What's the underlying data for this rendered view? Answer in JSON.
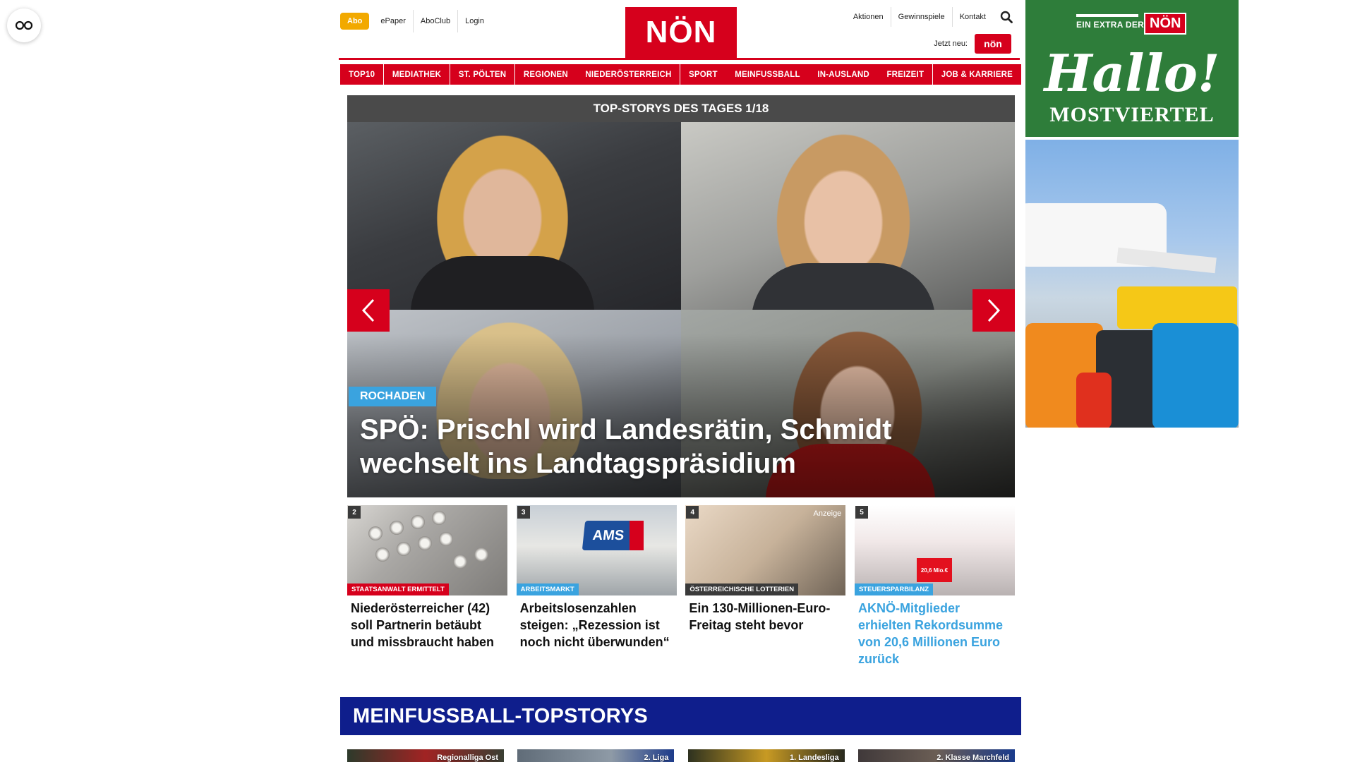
{
  "header": {
    "abo": "Abo",
    "util_links": [
      "ePaper",
      "AboClub",
      "Login"
    ],
    "logo": "NÖN",
    "right_links": [
      "Aktionen",
      "Gewinnspiele",
      "Kontakt"
    ],
    "jetzt_neu": "Jetzt neu:",
    "mini_logo": "nön"
  },
  "nav": [
    "TOP10",
    "MEDIATHEK",
    "ST. PÖLTEN",
    "REGIONEN",
    "NIEDERÖSTERREICH",
    "SPORT",
    "MEINFUSSBALL",
    "IN-AUSLAND",
    "FREIZEIT",
    "JOB & KARRIERE"
  ],
  "top_stories": {
    "heading": "TOP-STORYS DES TAGES 1/18",
    "tag": "ROCHADEN",
    "title": "SPÖ: Prischl wird Landesrätin, Schmidt wechselt ins Landtagspräsidium"
  },
  "cards": [
    {
      "num": "2",
      "tag": "STAATSANWALT ERMITTELT",
      "tag_color": "#d6001c",
      "title": "Niederösterreicher (42) soll Partnerin betäubt und missbraucht haben",
      "ad": ""
    },
    {
      "num": "3",
      "tag": "ARBEITSMARKT",
      "tag_color": "#3aa3df",
      "title": "Arbeitslosenzahlen steigen: „Rezession ist noch nicht überwunden“",
      "ad": ""
    },
    {
      "num": "4",
      "tag": "ÖSTERREICHISCHE LOTTERIEN",
      "tag_color": "#3a3a3a",
      "title": "Ein 130-Millionen-Euro-Freitag steht bevor",
      "ad": "Anzeige"
    },
    {
      "num": "5",
      "tag": "STEUERSPARBILANZ",
      "tag_color": "#3aa3df",
      "title": "AKNÖ-Mitglieder erhielten Rekordsumme von 20,6 Millionen Euro zurück",
      "ad": ""
    }
  ],
  "card_image_text": {
    "ams": "AMS",
    "check": "20,6 Mio.€"
  },
  "meinfussball": {
    "heading": "MEINFUSSBALL-TOPSTORYS",
    "thumbs": [
      "Regionalliga Ost",
      "2. Liga",
      "1. Landesliga",
      "2. Klasse Marchfeld"
    ]
  },
  "ad": {
    "extra": "EIN EXTRA DER",
    "noen": "NÖN",
    "hallo": "Hallo!",
    "region": "MOSTVIERTEL"
  },
  "colors": {
    "brand_red": "#d6001c",
    "accent_blue": "#3aa3df",
    "fussball_blue": "#0f1e8c",
    "ad_green": "#2e7d3a"
  },
  "icons": {
    "reader": "glasses-icon",
    "search": "search-icon",
    "prev": "chevron-left-icon",
    "next": "chevron-right-icon"
  }
}
